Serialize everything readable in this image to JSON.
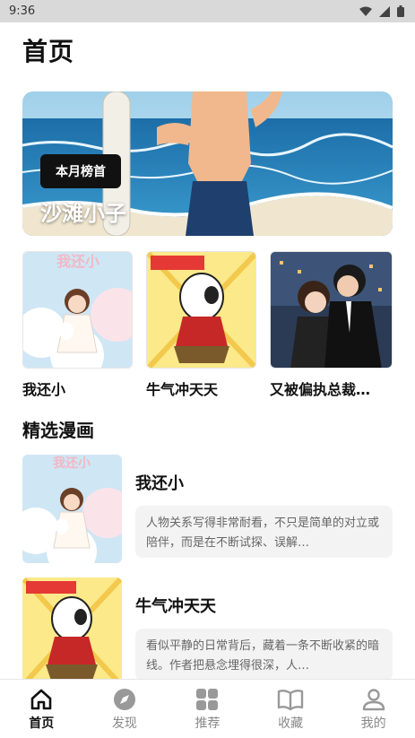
{
  "status": {
    "time": "9:36"
  },
  "page": {
    "title": "首页"
  },
  "hero": {
    "badge": "本月榜首",
    "title": "沙滩小子"
  },
  "cards": [
    {
      "title": "我还小",
      "cover_word": "我还小"
    },
    {
      "title": "牛气冲天天"
    },
    {
      "title": "又被偏执总裁…"
    }
  ],
  "section": {
    "title": "精选漫画"
  },
  "list": [
    {
      "title": "我还小",
      "desc": "人物关系写得非常耐看，不只是简单的对立或陪伴，而是在不断试探、误解…",
      "cover_word": "我还小"
    },
    {
      "title": "牛气冲天天",
      "desc": "看似平静的日常背后，藏着一条不断收紧的暗线。作者把悬念埋得很深，人…"
    }
  ],
  "tabs": [
    {
      "label": "首页",
      "icon": "home-icon",
      "active": true
    },
    {
      "label": "发现",
      "icon": "compass-icon",
      "active": false
    },
    {
      "label": "推荐",
      "icon": "grid-icon",
      "active": false
    },
    {
      "label": "收藏",
      "icon": "book-icon",
      "active": false
    },
    {
      "label": "我的",
      "icon": "person-icon",
      "active": false
    }
  ],
  "colors": {
    "accent": "#111111",
    "inactive": "#888888",
    "sea": "#2e7fb6",
    "sky": "#bfe0f2"
  }
}
